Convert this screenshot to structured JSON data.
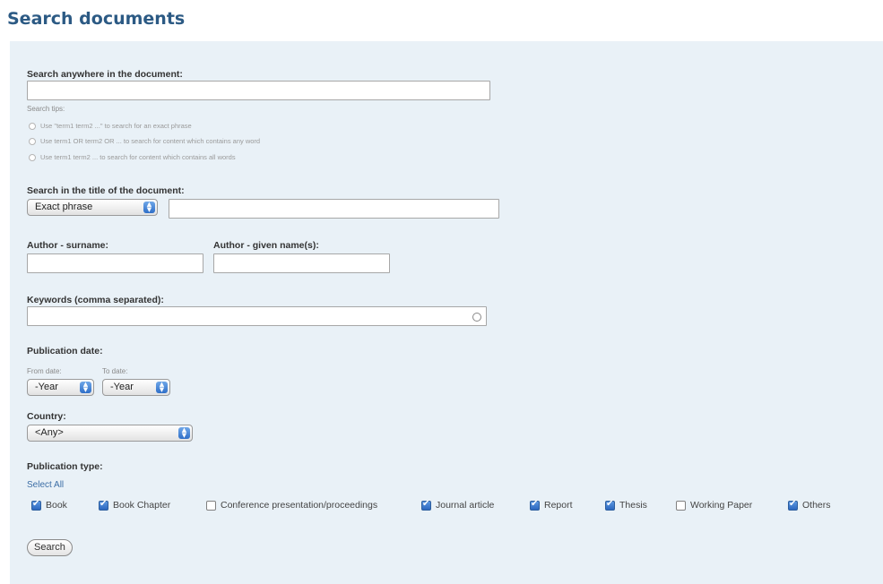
{
  "page": {
    "title": "Search documents"
  },
  "anywhere": {
    "label": "Search anywhere in the document:",
    "value": "",
    "tips_label": "Search tips:",
    "tips": [
      "Use \"term1 term2 ...\" to search for an exact phrase",
      "Use term1 OR term2 OR ... to search for content which contains any word",
      "Use term1 term2 ... to search for content which contains all words"
    ]
  },
  "title_search": {
    "label": "Search in the title of the document:",
    "mode": "Exact phrase",
    "value": ""
  },
  "author": {
    "surname_label": "Author - surname:",
    "given_label": "Author - given name(s):",
    "surname_value": "",
    "given_value": ""
  },
  "keywords": {
    "label": "Keywords (comma separated):",
    "value": ""
  },
  "pubdate": {
    "label": "Publication date:",
    "from_label": "From date:",
    "to_label": "To date:",
    "from_value": "-Year",
    "to_value": "-Year"
  },
  "country": {
    "label": "Country:",
    "value": "<Any>"
  },
  "pubtype": {
    "label": "Publication type:",
    "select_all": "Select All",
    "options": [
      {
        "label": "Book",
        "checked": true
      },
      {
        "label": "Book Chapter",
        "checked": true
      },
      {
        "label": "Conference presentation/proceedings",
        "checked": false
      },
      {
        "label": "Journal article",
        "checked": true
      },
      {
        "label": "Report",
        "checked": true
      },
      {
        "label": "Thesis",
        "checked": true
      },
      {
        "label": "Working Paper",
        "checked": false
      },
      {
        "label": "Others",
        "checked": true
      }
    ]
  },
  "search_button": "Search"
}
